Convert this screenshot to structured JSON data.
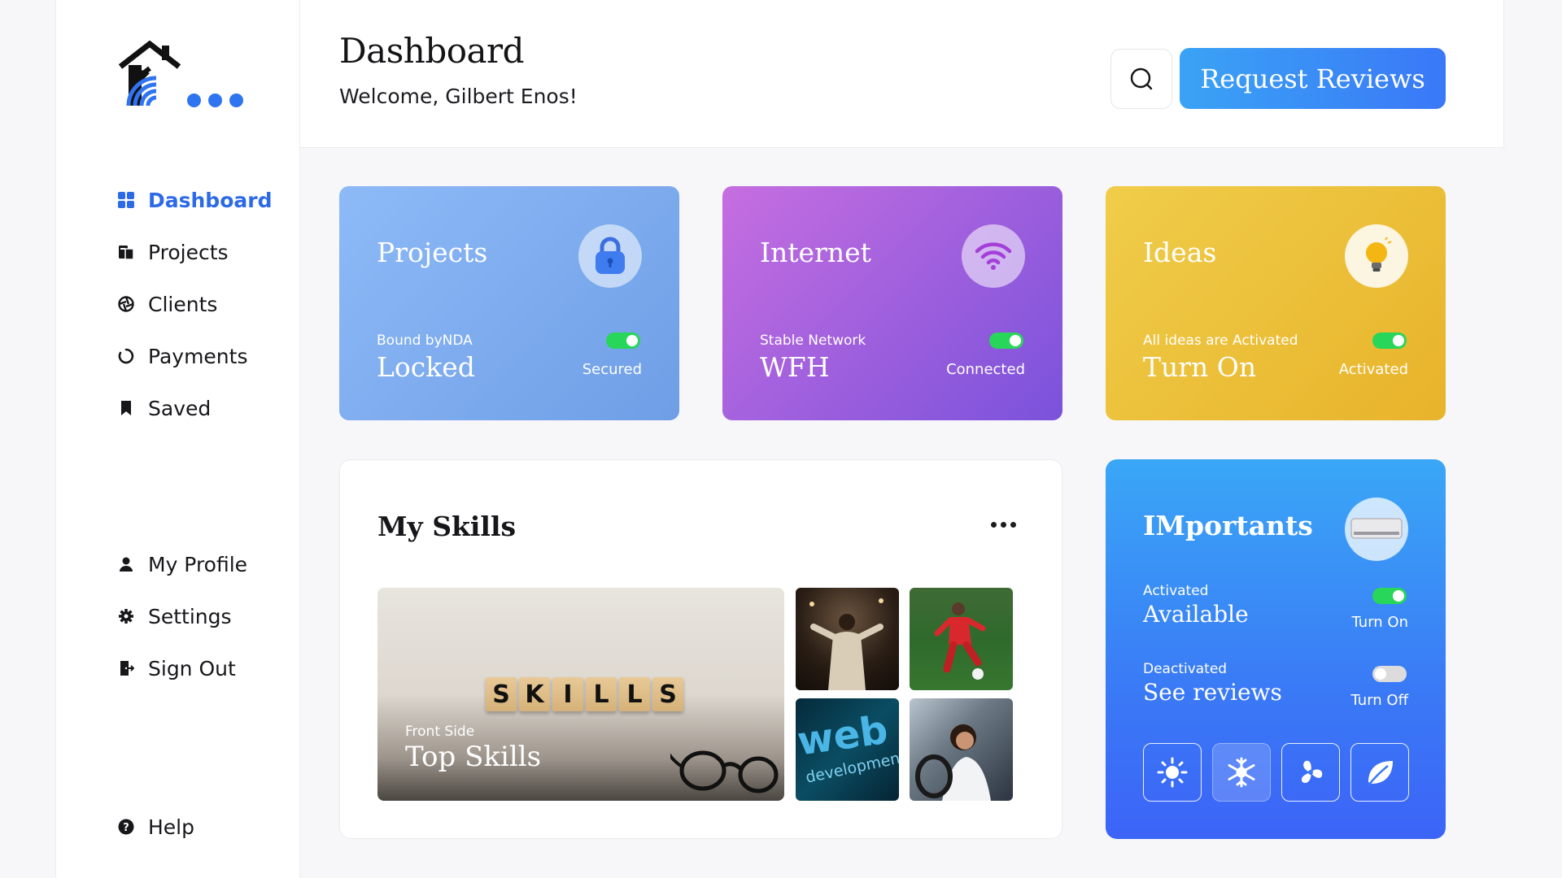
{
  "sidebar": {
    "main_items": [
      {
        "label": "Dashboard",
        "icon": "grid-icon",
        "active": true
      },
      {
        "label": "Projects",
        "icon": "folder-icon"
      },
      {
        "label": "Clients",
        "icon": "aperture-icon"
      },
      {
        "label": "Payments",
        "icon": "circle-progress-icon"
      },
      {
        "label": "Saved",
        "icon": "bookmark-icon"
      }
    ],
    "user_items": [
      {
        "label": "My Profile",
        "icon": "user-icon"
      },
      {
        "label": "Settings",
        "icon": "gear-icon"
      },
      {
        "label": "Sign Out",
        "icon": "sign-out-icon"
      }
    ],
    "help": {
      "label": "Help",
      "icon": "question-icon"
    }
  },
  "header": {
    "title": "Dashboard",
    "welcome": "Welcome, Gilbert Enos!",
    "request_label": "Request Reviews"
  },
  "cards": {
    "projects": {
      "title": "Projects",
      "sub": "Bound byNDA",
      "value": "Locked",
      "status": "Secured",
      "toggle_on": true
    },
    "internet": {
      "title": "Internet",
      "sub": "Stable Network",
      "value": "WFH",
      "status": "Connected",
      "toggle_on": true
    },
    "ideas": {
      "title": "Ideas",
      "sub": "All ideas are Activated",
      "value": "Turn On",
      "status": "Activated",
      "toggle_on": true
    }
  },
  "skills": {
    "title": "My Skills",
    "tile_letters": [
      "S",
      "K",
      "I",
      "L",
      "L",
      "S"
    ],
    "main_sub": "Front Side",
    "main_title": "Top Skills",
    "thumb_web_text": "web",
    "thumb_web_sub": "development"
  },
  "importants": {
    "title": "IMportants",
    "row1": {
      "sub": "Activated",
      "value": "Available",
      "status": "Turn On",
      "toggle_on": true
    },
    "row2": {
      "sub": "Deactivated",
      "value": "See reviews",
      "status": "Turn Off",
      "toggle_on": false
    },
    "modes": [
      "sun-icon",
      "snowflake-icon",
      "fan-icon",
      "leaf-icon"
    ],
    "active_mode": "snowflake-icon"
  },
  "colors": {
    "accent": "#2d6ae8",
    "toggle_on": "#28d65a",
    "toggle_off": "#dcdcdc"
  }
}
